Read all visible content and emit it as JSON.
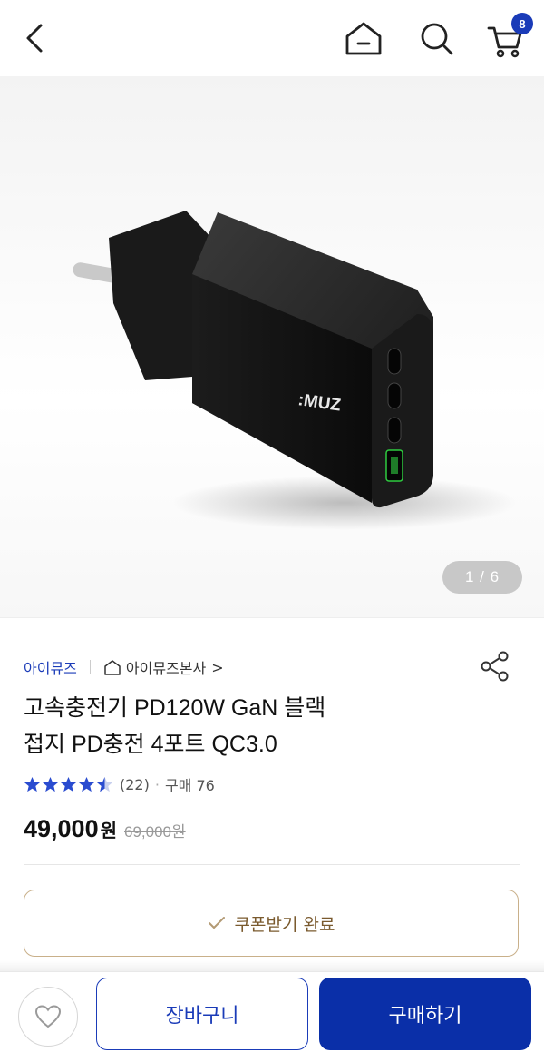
{
  "header": {
    "back_icon": "chevron-left-icon",
    "home_icon": "home-icon",
    "search_icon": "search-icon",
    "cart_icon": "cart-icon",
    "cart_count": "8"
  },
  "gallery": {
    "counter": "1 / 6",
    "product_logo_text": ":MUZ"
  },
  "product": {
    "brand": "아이뮤즈",
    "store": "아이뮤즈본사",
    "store_chevron": ">",
    "title_line1": "고속충전기 PD120W GaN 블랙",
    "title_line2": "접지 PD충전 4포트 QC3.0",
    "rating": 4.5,
    "review_count": "(22)",
    "separator": "·",
    "purchase_label": "구매 76",
    "price": "49,000",
    "price_unit": "원",
    "original_price": "69,000원"
  },
  "coupon": {
    "label": "쿠폰받기 완료"
  },
  "actions": {
    "wish_icon": "heart-icon",
    "add_to_cart": "장바구니",
    "buy_now": "구매하기"
  },
  "colors": {
    "accent": "#1a3bb8",
    "buy_button": "#0a2fa8",
    "coupon_border": "#c9b08a",
    "star": "#2a4cd0"
  }
}
